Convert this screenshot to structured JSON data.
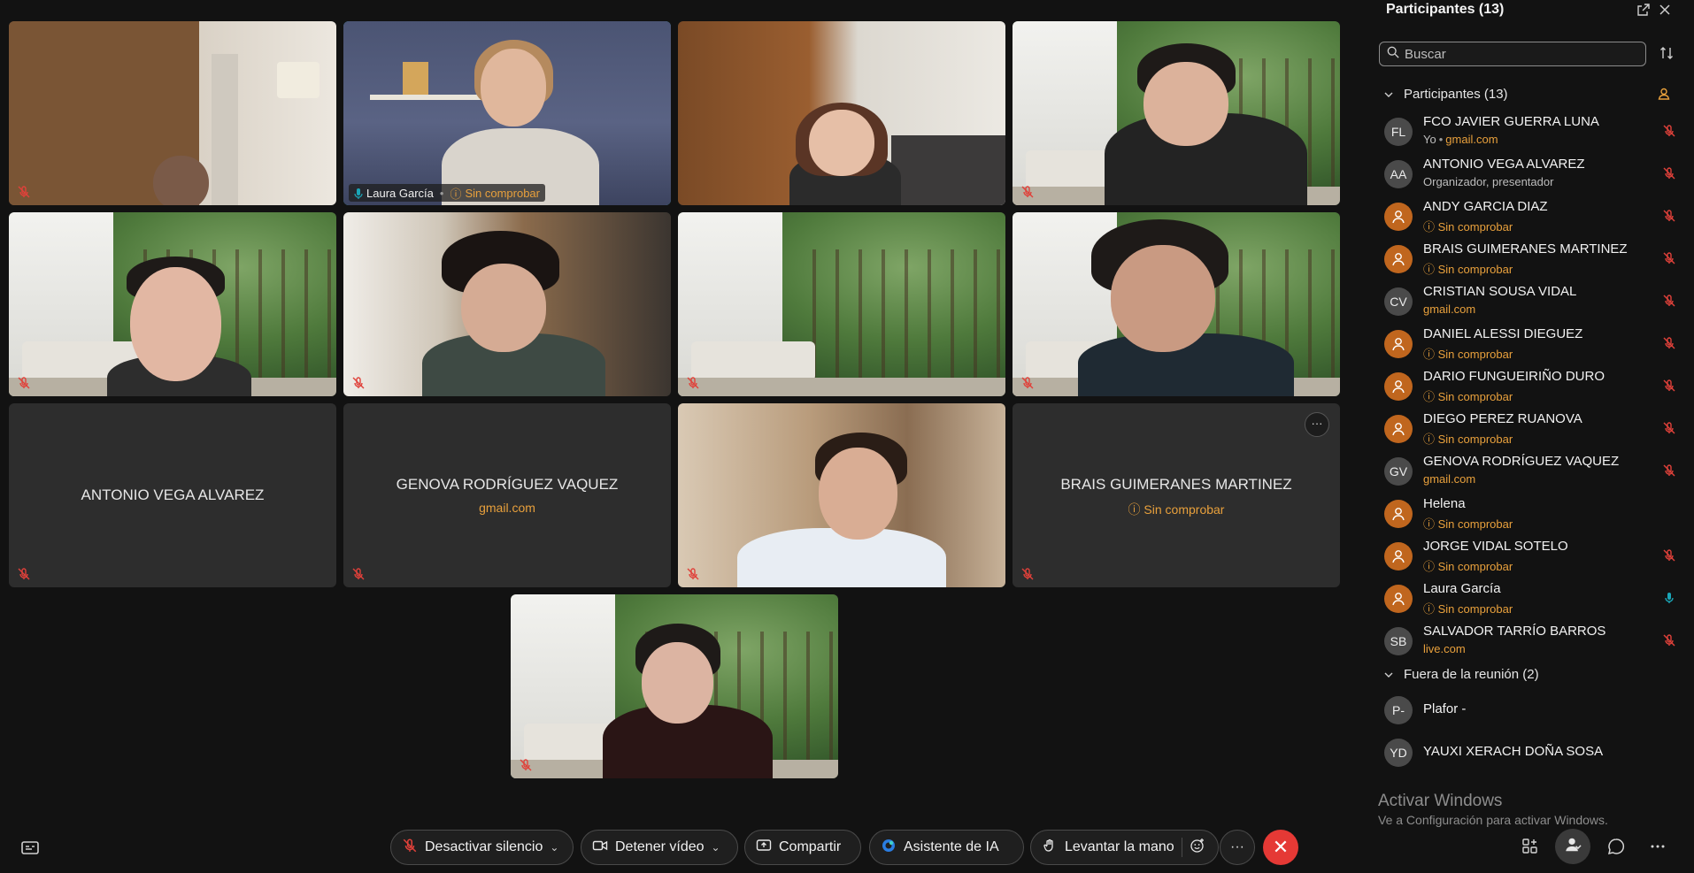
{
  "tiles": {
    "t2": {
      "name": "Laura García",
      "status": "Sin comprobar"
    },
    "t9": {
      "name": "ANTONIO VEGA ALVAREZ"
    },
    "t10": {
      "name": "GENOVA RODRÍGUEZ VAQUEZ",
      "sub": "gmail.com"
    },
    "t12": {
      "name": "BRAIS GUIMERANES MARTINEZ",
      "sub": "Sin comprobar",
      "more": "···"
    }
  },
  "controls": {
    "mute_label": "Desactivar silencio",
    "video_label": "Detener vídeo",
    "share_label": "Compartir",
    "ai_label": "Asistente de IA",
    "hand_label": "Levantar la mano",
    "more_label": "···",
    "end_label": "✕"
  },
  "panel": {
    "title": "Participantes (13)",
    "search_placeholder": "Buscar",
    "in_meeting_header": "Participantes (13)",
    "participants": [
      {
        "initials": "FL",
        "name": "FCO JAVIER GUERRA LUNA",
        "sub_prefix": "Yo",
        "sub": "gmail.com",
        "avatar": "initials",
        "mic": "muted"
      },
      {
        "initials": "AA",
        "name": "ANTONIO VEGA ALVAREZ",
        "sub": "Organizador, presentador",
        "avatar": "initials",
        "mic": "muted"
      },
      {
        "initials": "",
        "name": "ANDY GARCIA DIAZ",
        "sub": "Sin comprobar",
        "avatar": "guest",
        "mic": "muted"
      },
      {
        "initials": "",
        "name": "BRAIS GUIMERANES MARTINEZ",
        "sub": "Sin comprobar",
        "avatar": "guest",
        "mic": "muted"
      },
      {
        "initials": "CV",
        "name": "CRISTIAN SOUSA VIDAL",
        "sub": "gmail.com",
        "avatar": "initials",
        "mic": "muted"
      },
      {
        "initials": "",
        "name": "DANIEL ALESSI DIEGUEZ",
        "sub": "Sin comprobar",
        "avatar": "guest",
        "mic": "muted"
      },
      {
        "initials": "",
        "name": "DARIO FUNGUEIRIÑO DURO",
        "sub": "Sin comprobar",
        "avatar": "guest",
        "mic": "muted"
      },
      {
        "initials": "",
        "name": "DIEGO PEREZ RUANOVA",
        "sub": "Sin comprobar",
        "avatar": "guest",
        "mic": "muted"
      },
      {
        "initials": "GV",
        "name": "GENOVA RODRÍGUEZ VAQUEZ",
        "sub": "gmail.com",
        "avatar": "initials",
        "mic": "muted"
      },
      {
        "initials": "",
        "name": "Helena",
        "sub": "Sin comprobar",
        "avatar": "guest",
        "mic": "none"
      },
      {
        "initials": "",
        "name": "JORGE VIDAL SOTELO",
        "sub": "Sin comprobar",
        "avatar": "guest",
        "mic": "muted"
      },
      {
        "initials": "",
        "name": "Laura García",
        "sub": "Sin comprobar",
        "avatar": "guest",
        "mic": "active"
      },
      {
        "initials": "SB",
        "name": "SALVADOR TARRÍO BARROS",
        "sub": "live.com",
        "avatar": "initials",
        "mic": "muted"
      }
    ],
    "out_header": "Fuera de la reunión (2)",
    "outside": [
      {
        "initials": "P-",
        "name": "Plafor -"
      },
      {
        "initials": "YD",
        "name": "YAUXI XERACH DOÑA SOSA"
      }
    ]
  },
  "watermark": {
    "line1": "Activar Windows",
    "line2": "Ve a Configuración para activar Windows."
  },
  "colors": {
    "accent": "#1aa6b7",
    "unverified": "#e8a03c",
    "muted_icon": "#e0413a",
    "end_call": "#e53935",
    "guest_avatar": "#c0661e"
  }
}
